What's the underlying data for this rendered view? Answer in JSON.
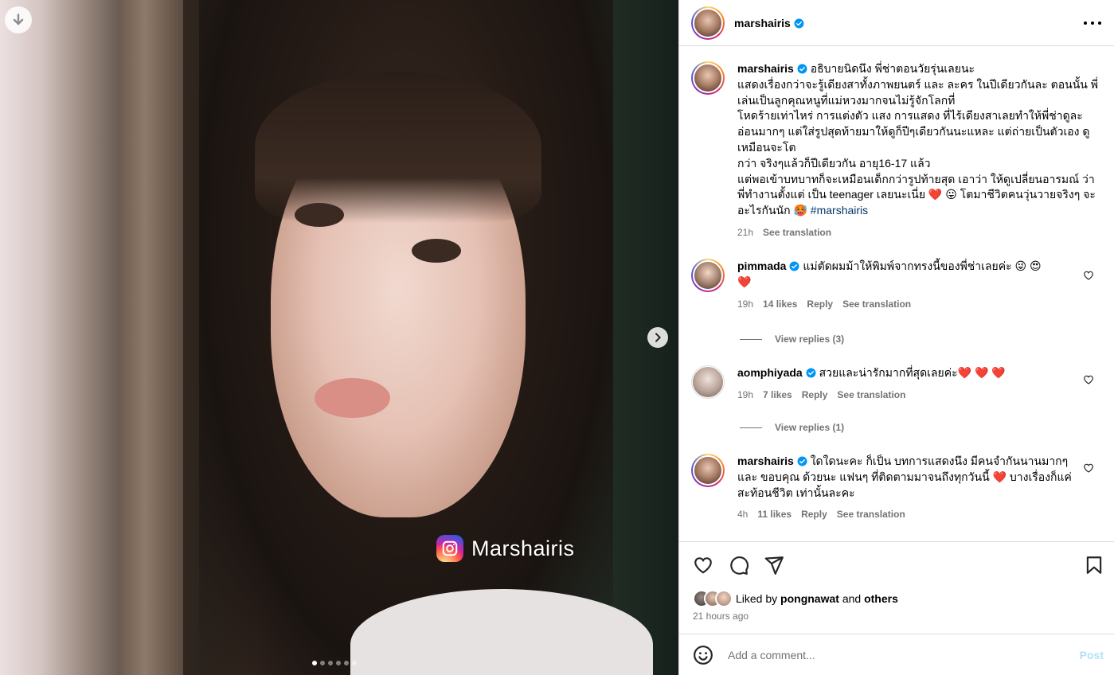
{
  "media": {
    "watermark_text": "Marshairis",
    "slide_count": 6,
    "active_slide": 1
  },
  "header": {
    "username": "marshairis",
    "more_icon": "more-horizontal-icon"
  },
  "caption": {
    "username": "marshairis",
    "text": "อธิบายนิดนึง พี่ช่าตอนวัยรุ่นเลยนะ\nแสดงเรื่องกว่าจะรู้เดียงสาทั้งภาพยนตร์ และ ละคร ในปีเดียวกันละ ตอนนั้น พี่เล่นเป็นลูกคุณหนูที่แม่หวงมากจนไม่รู้จักโลกที่\nโหดร้ายเท่าไหร่ การแต่งตัว แสง การแสดง ที่ไร้เดียงสาเลยทำให้พี่ช่าดูละอ่อนมากๆ แต่ใส่รูปสุดท้ายมาให้ดูก็ปีๆเดียวกันนะแหละ แต่ถ่ายเป็นตัวเอง ดูเหมือนจะโต\nกว่า จริงๆแล้วก็ปีเดียวกัน อายุ16-17 แล้ว\nแต่พอเข้าบทบาทก็จะเหมือนเด็กกว่ารูปท้ายสุด เอาว่า ให้ดูเปลี่ยนอารมณ์ ว่าพี่ทำงานตั้งแต่ เป็น teenager เลยนะเนี่ย ❤️ 😛 โตมาชีวิตคนวุ่นวายจริงๆ จะอะไรกันนัก 🥵 ",
    "hashtag": "#marshairis",
    "time": "21h",
    "see_translation": "See translation"
  },
  "comments": [
    {
      "username": "pimmada",
      "text": "แม่ตัดผมม้าให้พิมพ์จากทรงนี้ของพี่ช่าเลยค่ะ 😜 😍\n❤️",
      "time": "19h",
      "likes": "14 likes",
      "reply": "Reply",
      "see_translation": "See translation",
      "view_replies": "View replies (3)"
    },
    {
      "username": "aomphiyada",
      "text": "สวยและน่ารักมากที่สุดเลยค่ะ❤️ ❤️ ❤️",
      "time": "19h",
      "likes": "7 likes",
      "reply": "Reply",
      "see_translation": "See translation",
      "view_replies": "View replies (1)"
    },
    {
      "username": "marshairis",
      "text": "ใดใดนะคะ ก็เป็น บทการแสดงนึง มีคนจำกันนานมากๆ และ ขอบคุณ ด้วยนะ แฟนๆ ที่ติดตามมาจนถึงทุกวันนี้ ❤️ บางเรื่องก็แค่สะท้อนชีวิต เท่านั้นละคะ",
      "time": "4h",
      "likes": "11 likes",
      "reply": "Reply",
      "see_translation": "See translation"
    }
  ],
  "actions": {
    "liked_prefix": "Liked by",
    "liked_user": "pongnawat",
    "liked_and": "and",
    "liked_others": "others",
    "time_ago": "21 hours ago"
  },
  "composer": {
    "placeholder": "Add a comment...",
    "post_label": "Post"
  }
}
